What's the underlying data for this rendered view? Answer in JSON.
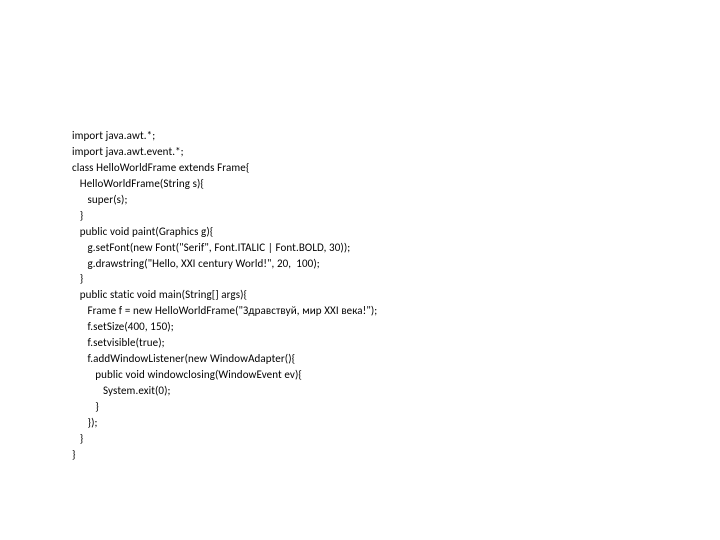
{
  "code": {
    "lines": [
      "import java.awt.*;",
      "import java.awt.event.*;",
      "class HelloWorldFrame extends Frame{",
      "   HelloWorldFrame(String s){",
      "      super(s);",
      "   }",
      "   public void paint(Graphics g){",
      "      g.setFont(new Font(\"Serif\", Font.ITALIC | Font.BOLD, 30));",
      "      g.drawstring(\"Hello, XXI century World!\", 20,  100);",
      "   }",
      "   public static void main(String[] args){",
      "      Frame f = new HelloWorldFrame(\"Здравствуй, мир XXI века!\");",
      "      f.setSize(400, 150);",
      "      f.setvisible(true);",
      "      f.addWindowListener(new WindowAdapter(){",
      "         public void windowclosing(WindowEvent ev){",
      "            System.exit(0);",
      "         }",
      "      });",
      "   }",
      "}"
    ]
  }
}
